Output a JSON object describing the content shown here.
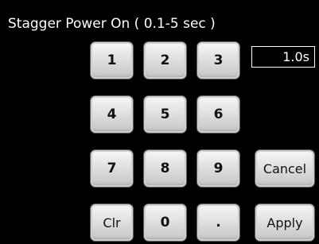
{
  "title": "Stagger Power On ( 0.1-5 sec )",
  "display": {
    "value": "1.0s"
  },
  "keys": {
    "k1": "1",
    "k2": "2",
    "k3": "3",
    "k4": "4",
    "k5": "5",
    "k6": "6",
    "k7": "7",
    "k8": "8",
    "k9": "9",
    "clr": "Clr",
    "k0": "0",
    "dot": "."
  },
  "actions": {
    "cancel": "Cancel",
    "apply": "Apply"
  },
  "colors": {
    "background": "#000000",
    "text": "#ffffff",
    "key_face": "#e1e1e1"
  }
}
